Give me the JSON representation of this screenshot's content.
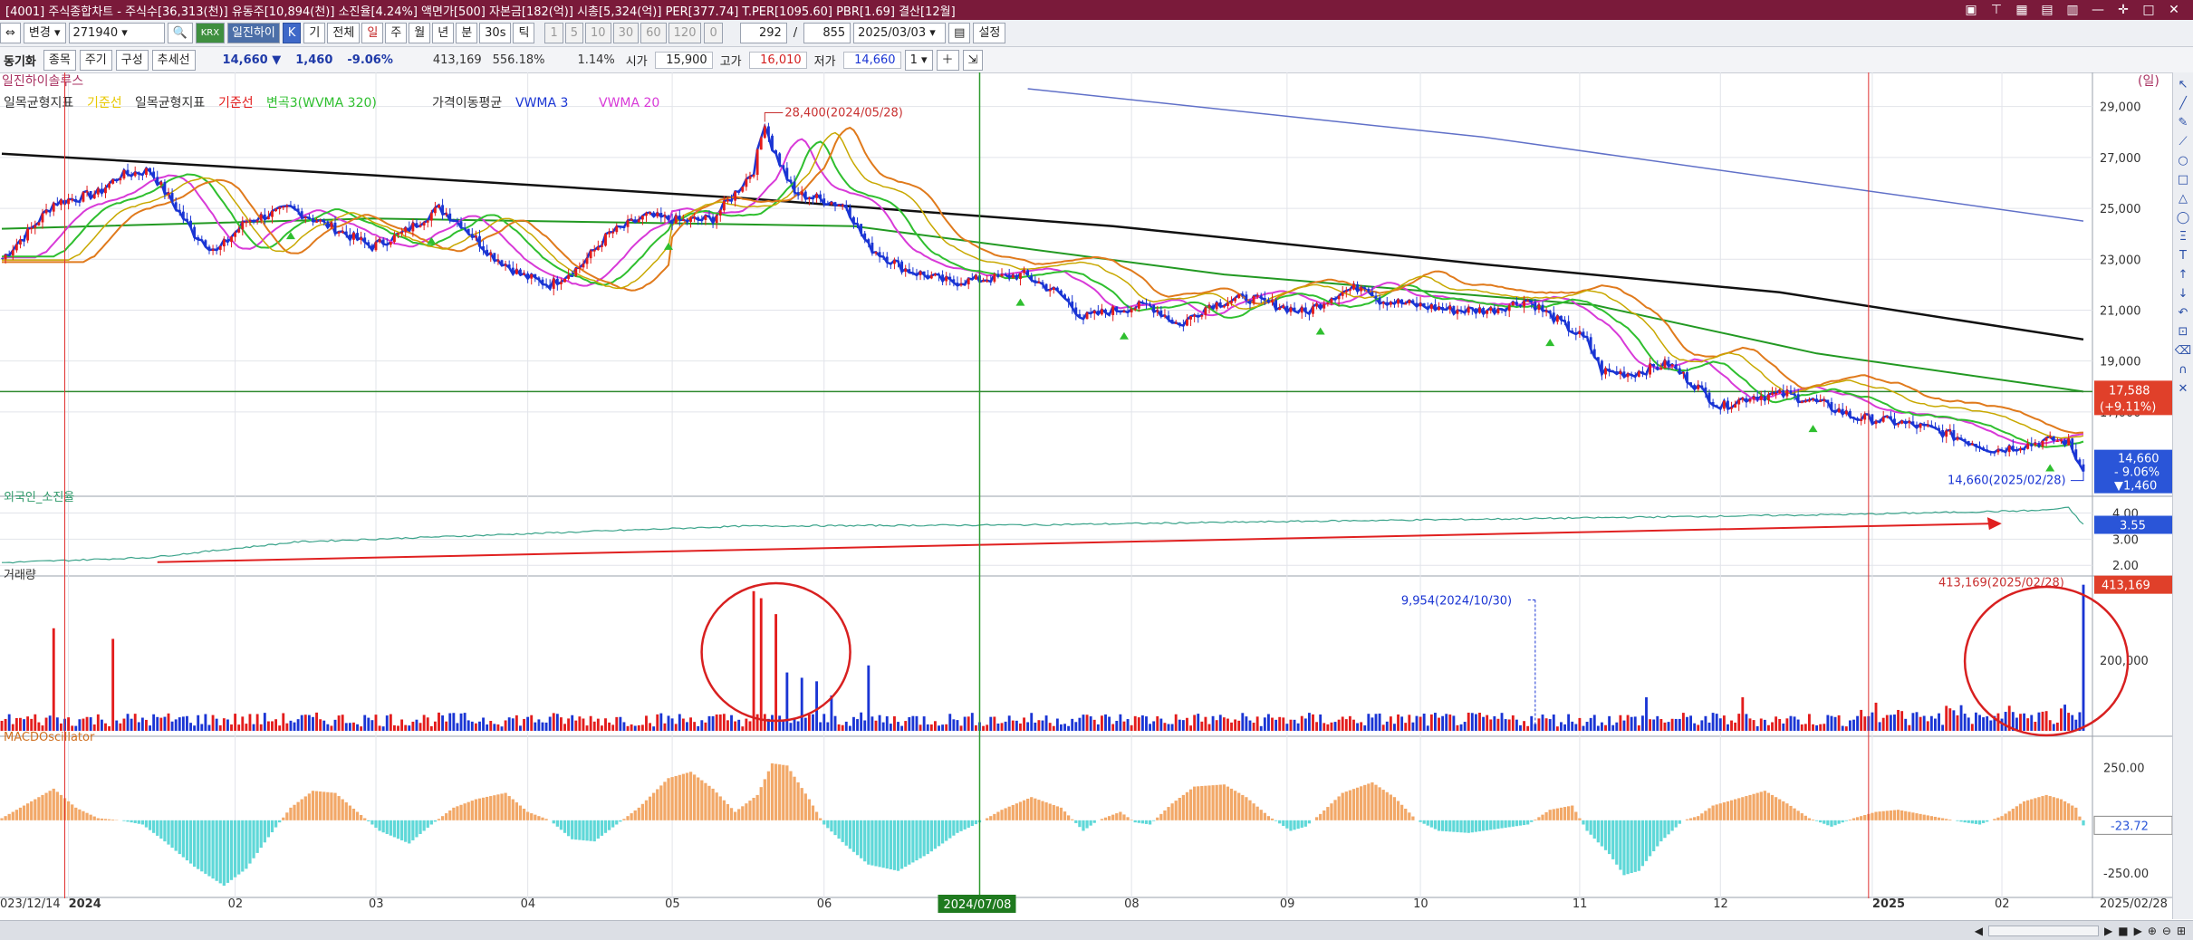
{
  "title_bar": {
    "title": "[4001] 주식종합차트 - 주식수[36,313(천)] 유동주[10,894(천)] 소진율[4.24%] 액면가[500] 자본금[182(억)] 시총[5,324(억)] PER[377.74] T.PER[1095.60] PBR[1.69] 결산[12월]"
  },
  "toolbar": {
    "change_label": "변경",
    "code": "271940",
    "name": "일진하이",
    "k_label": "K",
    "tabs": [
      "기",
      "전체",
      "일",
      "주",
      "월",
      "년",
      "분",
      "30s",
      "틱"
    ],
    "periods": [
      "1",
      "5",
      "10",
      "30",
      "60",
      "120"
    ],
    "zero": "0",
    "count": "292",
    "slash": "/",
    "total": "855",
    "date": "2025/03/03",
    "settings_label": "설정"
  },
  "info": {
    "sync_label": "동기화",
    "stock_btn": "종목",
    "period_btn": "주기",
    "compose_btn": "구성",
    "trend_btn": "추세선",
    "price": "14,660 ▼",
    "change": "1,460",
    "change_pct": "-9.06%",
    "volume": "413,169",
    "volume_pct": "556.18%",
    "turnover": "1.14%",
    "open_label": "시가",
    "open": "15,900",
    "high_label": "고가",
    "high": "16,010",
    "low_label": "저가",
    "low": "14,660",
    "page": "1"
  },
  "colors": {
    "up": "#e31c1c",
    "down": "#1a35d4",
    "macd_pos": "#f2a868",
    "macd_neg": "#5fd8d8",
    "titlebar": "#7a1a3a"
  },
  "chart_data": [
    {
      "type": "line",
      "panel": "price",
      "stock_name": "일진하이솔루스",
      "unit_marker": "(일)",
      "legend": [
        {
          "text": "일목균형지표",
          "color": "#333333"
        },
        {
          "text": "기준선",
          "color": "#e8c800"
        },
        {
          "text": "일목균형지표",
          "color": "#333333"
        },
        {
          "text": "기준선",
          "color": "#e31c1c"
        },
        {
          "text": "변곡3(WVMA 320)",
          "color": "#2fbf2f"
        },
        {
          "text": "가격이동평균",
          "color": "#333333"
        },
        {
          "text": "VWMA 3",
          "color": "#1a35d4"
        },
        {
          "text": "VWMA 20",
          "color": "#d83ad8"
        }
      ],
      "ylim": [
        13900,
        29700
      ],
      "yticks": [
        "29,000",
        "27,000",
        "25,000",
        "23,000",
        "21,000",
        "19,000",
        "17,000"
      ],
      "price_anchors": [
        [
          0,
          23000
        ],
        [
          8,
          24200
        ],
        [
          14,
          25200
        ],
        [
          26,
          25600
        ],
        [
          32,
          26300
        ],
        [
          40,
          26500
        ],
        [
          52,
          24000
        ],
        [
          58,
          23300
        ],
        [
          66,
          24500
        ],
        [
          78,
          25000
        ],
        [
          90,
          24200
        ],
        [
          100,
          23500
        ],
        [
          108,
          24000
        ],
        [
          118,
          25000
        ],
        [
          124,
          24400
        ],
        [
          132,
          23200
        ],
        [
          140,
          22400
        ],
        [
          148,
          22000
        ],
        [
          156,
          22700
        ],
        [
          164,
          24000
        ],
        [
          174,
          24700
        ],
        [
          184,
          24500
        ],
        [
          192,
          24600
        ],
        [
          198,
          25600
        ],
        [
          203,
          26500
        ],
        [
          206,
          28400
        ],
        [
          208,
          27400
        ],
        [
          214,
          25600
        ],
        [
          220,
          25400
        ],
        [
          228,
          25100
        ],
        [
          234,
          23500
        ],
        [
          244,
          22600
        ],
        [
          256,
          22100
        ],
        [
          264,
          22200
        ],
        [
          276,
          22400
        ],
        [
          286,
          21600
        ],
        [
          292,
          20700
        ],
        [
          300,
          21000
        ],
        [
          310,
          21200
        ],
        [
          318,
          20400
        ],
        [
          326,
          21200
        ],
        [
          336,
          21500
        ],
        [
          344,
          21200
        ],
        [
          352,
          20900
        ],
        [
          360,
          21600
        ],
        [
          368,
          22000
        ],
        [
          372,
          21400
        ],
        [
          382,
          21200
        ],
        [
          392,
          21000
        ],
        [
          402,
          21000
        ],
        [
          412,
          21400
        ],
        [
          420,
          20600
        ],
        [
          428,
          19800
        ],
        [
          432,
          18600
        ],
        [
          440,
          18500
        ],
        [
          450,
          18900
        ],
        [
          456,
          18200
        ],
        [
          464,
          17200
        ],
        [
          472,
          17600
        ],
        [
          482,
          17700
        ],
        [
          492,
          17300
        ],
        [
          500,
          16800
        ],
        [
          512,
          16600
        ],
        [
          522,
          16300
        ],
        [
          532,
          15800
        ],
        [
          538,
          15500
        ],
        [
          546,
          15700
        ],
        [
          554,
          15900
        ],
        [
          558,
          15800
        ],
        [
          562,
          14660
        ]
      ],
      "ma_lines": [
        {
          "name": "VWMA 3",
          "color": "#1a35d4",
          "width": 2.5,
          "lag": 0,
          "offset": 0
        },
        {
          "name": "VWMA 20",
          "color": "#d83ad8",
          "width": 2,
          "lag": 9,
          "offset": 250
        },
        {
          "name": "기준선",
          "color": "#2fbf2f",
          "width": 2,
          "lag": 14,
          "offset": 150
        },
        {
          "name": "기준선",
          "color": "#e07a1c",
          "width": 2,
          "lag": 22,
          "offset": 700
        },
        {
          "name": "일목균형지표",
          "color": "#c8a800",
          "width": 1.5,
          "lag": 18,
          "offset": 500
        }
      ],
      "long_lines": [
        {
          "name": "가격이동평균",
          "color": "#111111",
          "width": 2.5,
          "points": [
            [
              0,
              27150
            ],
            [
              100,
              26300
            ],
            [
              200,
              25400
            ],
            [
              300,
              24300
            ],
            [
              400,
              22800
            ],
            [
              480,
              21700
            ],
            [
              562,
              19850
            ]
          ]
        },
        {
          "name": "변곡3(WVMA 320)",
          "color": "#229922",
          "width": 2,
          "points": [
            [
              0,
              24200
            ],
            [
              100,
              24600
            ],
            [
              230,
              24300
            ],
            [
              330,
              22400
            ],
            [
              430,
              21200
            ],
            [
              490,
              19300
            ],
            [
              562,
              17800
            ]
          ]
        },
        {
          "name": "long_blue",
          "color": "#6070c8",
          "width": 1.5,
          "points": [
            [
              277,
              29700
            ],
            [
              400,
              27800
            ],
            [
              562,
              24500
            ]
          ]
        }
      ],
      "hline": {
        "value": 17800,
        "color": "#2f8a2f"
      },
      "current_value": "17,588",
      "current_change": "(+9.11%)",
      "last_price": "14,660",
      "last_change_pct": "- 9.06%",
      "last_change": "▼1,460",
      "annotations": [
        {
          "text": "28,400(2024/05/28)",
          "x": 206,
          "y": 28400,
          "color": "#c83030"
        },
        {
          "text": "14,660(2025/02/28)",
          "x": 562,
          "y": 14660,
          "color": "#1a35d4"
        }
      ]
    },
    {
      "type": "line",
      "panel": "foreign",
      "title": "외국인_소진율",
      "ylim": [
        1.8,
        4.4
      ],
      "yticks": [
        "4.00",
        "3.00",
        "2.00"
      ],
      "last_value": "3.55",
      "points": [
        [
          0,
          2.1
        ],
        [
          40,
          2.3
        ],
        [
          80,
          2.9
        ],
        [
          140,
          3.2
        ],
        [
          200,
          3.5
        ],
        [
          280,
          3.55
        ],
        [
          360,
          3.7
        ],
        [
          420,
          3.8
        ],
        [
          500,
          3.95
        ],
        [
          550,
          4.1
        ],
        [
          558,
          4.2
        ],
        [
          562,
          3.55
        ]
      ],
      "arrow": {
        "from": [
          42,
          2.12
        ],
        "to": [
          538,
          3.6
        ],
        "color": "#e02020"
      }
    },
    {
      "type": "bar",
      "panel": "volume",
      "title": "거래량",
      "ylim": [
        0,
        420000
      ],
      "yticks": [
        "200,000"
      ],
      "last_value": "413,169",
      "bars": [
        {
          "x": 14,
          "value": 290000,
          "dir": "up"
        },
        {
          "x": 30,
          "value": 260000,
          "dir": "up"
        },
        {
          "x": 203,
          "value": 395000,
          "dir": "up"
        },
        {
          "x": 205,
          "value": 375000,
          "dir": "up"
        },
        {
          "x": 209,
          "value": 330000,
          "dir": "up"
        },
        {
          "x": 212,
          "value": 165000,
          "dir": "down"
        },
        {
          "x": 216,
          "value": 150000,
          "dir": "down"
        },
        {
          "x": 220,
          "value": 140000,
          "dir": "down"
        },
        {
          "x": 224,
          "value": 100000,
          "dir": "down"
        },
        {
          "x": 234,
          "value": 185000,
          "dir": "down"
        },
        {
          "x": 562,
          "value": 413169,
          "dir": "down"
        }
      ],
      "annotations": [
        {
          "text": "9,954(2024/10/30)",
          "x": 414,
          "y": 370000,
          "color": "#1a35d4"
        },
        {
          "text": "413,169(2025/02/28)",
          "x": 562,
          "y": 413169,
          "color": "#c83030"
        }
      ]
    },
    {
      "type": "bar",
      "panel": "macd",
      "title": "MACDOscillator",
      "ylim": [
        -340,
        360
      ],
      "yticks": [
        "250.00",
        "-250.00"
      ],
      "last_value": "-23.72",
      "anchors": [
        [
          0,
          10
        ],
        [
          8,
          90
        ],
        [
          14,
          150
        ],
        [
          20,
          60
        ],
        [
          26,
          10
        ],
        [
          32,
          0
        ],
        [
          38,
          -20
        ],
        [
          44,
          -100
        ],
        [
          52,
          -220
        ],
        [
          60,
          -310
        ],
        [
          66,
          -230
        ],
        [
          72,
          -80
        ],
        [
          78,
          60
        ],
        [
          84,
          140
        ],
        [
          90,
          130
        ],
        [
          96,
          40
        ],
        [
          102,
          -50
        ],
        [
          110,
          -110
        ],
        [
          116,
          -20
        ],
        [
          122,
          60
        ],
        [
          128,
          100
        ],
        [
          136,
          130
        ],
        [
          142,
          40
        ],
        [
          148,
          0
        ],
        [
          154,
          -90
        ],
        [
          160,
          -100
        ],
        [
          166,
          -20
        ],
        [
          172,
          60
        ],
        [
          180,
          200
        ],
        [
          186,
          230
        ],
        [
          192,
          150
        ],
        [
          198,
          40
        ],
        [
          204,
          120
        ],
        [
          208,
          270
        ],
        [
          212,
          260
        ],
        [
          218,
          100
        ],
        [
          222,
          -20
        ],
        [
          228,
          -120
        ],
        [
          234,
          -210
        ],
        [
          242,
          -240
        ],
        [
          250,
          -160
        ],
        [
          258,
          -60
        ],
        [
          264,
          -10
        ],
        [
          270,
          50
        ],
        [
          278,
          110
        ],
        [
          286,
          60
        ],
        [
          292,
          -50
        ],
        [
          296,
          0
        ],
        [
          302,
          40
        ],
        [
          306,
          -10
        ],
        [
          310,
          -20
        ],
        [
          316,
          80
        ],
        [
          322,
          160
        ],
        [
          330,
          170
        ],
        [
          336,
          110
        ],
        [
          342,
          20
        ],
        [
          348,
          -50
        ],
        [
          352,
          -30
        ],
        [
          356,
          30
        ],
        [
          362,
          130
        ],
        [
          370,
          180
        ],
        [
          376,
          110
        ],
        [
          382,
          0
        ],
        [
          388,
          -50
        ],
        [
          396,
          -60
        ],
        [
          404,
          -40
        ],
        [
          412,
          -20
        ],
        [
          418,
          50
        ],
        [
          424,
          70
        ],
        [
          428,
          -50
        ],
        [
          434,
          -160
        ],
        [
          438,
          -260
        ],
        [
          442,
          -240
        ],
        [
          448,
          -100
        ],
        [
          454,
          0
        ],
        [
          458,
          20
        ],
        [
          462,
          70
        ],
        [
          470,
          110
        ],
        [
          476,
          140
        ],
        [
          482,
          80
        ],
        [
          488,
          10
        ],
        [
          494,
          -30
        ],
        [
          500,
          10
        ],
        [
          506,
          40
        ],
        [
          512,
          50
        ],
        [
          518,
          30
        ],
        [
          524,
          10
        ],
        [
          530,
          -10
        ],
        [
          534,
          -20
        ],
        [
          540,
          20
        ],
        [
          546,
          90
        ],
        [
          552,
          120
        ],
        [
          556,
          100
        ],
        [
          560,
          60
        ],
        [
          562,
          -24
        ]
      ]
    },
    {
      "type": "axis",
      "panel": "dates",
      "bar_count": 563,
      "start_label": "023/12/14",
      "end_label": "2025/02/28",
      "cursor_label": "2024/07/08",
      "cursor_x": 264,
      "red_marker_x": 17,
      "red_marker2_x": 504,
      "ticks": [
        {
          "x": 18,
          "label": "2024",
          "bold": true
        },
        {
          "x": 63,
          "label": "02"
        },
        {
          "x": 101,
          "label": "03"
        },
        {
          "x": 142,
          "label": "04"
        },
        {
          "x": 181,
          "label": "05"
        },
        {
          "x": 222,
          "label": "06"
        },
        {
          "x": 305,
          "label": "08"
        },
        {
          "x": 347,
          "label": "09"
        },
        {
          "x": 383,
          "label": "10"
        },
        {
          "x": 426,
          "label": "11"
        },
        {
          "x": 464,
          "label": "12"
        },
        {
          "x": 505,
          "label": "2025",
          "bold": true
        },
        {
          "x": 540,
          "label": "02"
        }
      ]
    }
  ]
}
